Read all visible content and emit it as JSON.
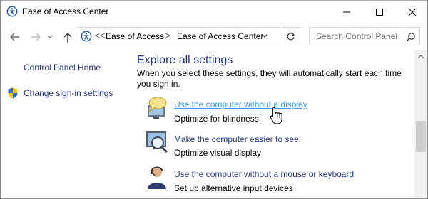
{
  "window": {
    "title": "Ease of Access Center",
    "controls": [
      "minimize-icon",
      "maximize-icon",
      "close-icon"
    ]
  },
  "addressbar": {
    "overflow": "<<",
    "breadcrumbs": [
      "Ease of Access",
      "Ease of Access Center"
    ],
    "separator": ">",
    "search_placeholder": "Search Control Panel"
  },
  "sidebar": {
    "items": [
      {
        "label": "Control Panel Home",
        "icon": ""
      },
      {
        "label": "Change sign-in settings",
        "icon": "uac-shield-icon"
      }
    ]
  },
  "main": {
    "section_title": "Explore all settings",
    "section_desc": "When you select these settings, they will automatically start each time you sign in.",
    "items": [
      {
        "link": "Use the computer without a display",
        "sub": "Optimize for blindness",
        "icon": "speech-bubble-monitor-icon",
        "hovered": true
      },
      {
        "link": "Make the computer easier to see",
        "sub": "Optimize visual display",
        "icon": "magnifier-monitor-icon",
        "hovered": false
      },
      {
        "link": "Use the computer without a mouse or keyboard",
        "sub": "Set up alternative input devices",
        "icon": "person-headset-icon",
        "hovered": false
      }
    ]
  },
  "colors": {
    "link": "#1e3287",
    "link_hover": "#3399ff",
    "border": "#d9d9d9"
  }
}
